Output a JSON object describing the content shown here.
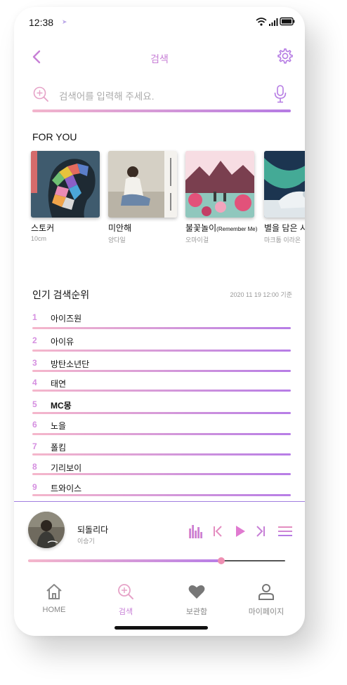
{
  "status": {
    "time": "12:38"
  },
  "header": {
    "title": "검색"
  },
  "search": {
    "placeholder": "검색어를 입력해 주세요."
  },
  "for_you": {
    "title": "FOR YOU",
    "albums": [
      {
        "name": "스토커",
        "artist": "10cm"
      },
      {
        "name": "미안해",
        "artist": "양다일"
      },
      {
        "name": "불꽃놀이",
        "name_suffix": "(Remember Me)",
        "artist": "오마이걸"
      },
      {
        "name": "별을 담은 시",
        "artist": "마크툽 이라온"
      }
    ]
  },
  "ranking": {
    "title": "인기 검색순위",
    "date": "2020 11 19 12:00 기준",
    "items": [
      {
        "rank": "1",
        "name": "아이즈원"
      },
      {
        "rank": "2",
        "name": "아이유"
      },
      {
        "rank": "3",
        "name": "방탄소년단"
      },
      {
        "rank": "4",
        "name": "태연"
      },
      {
        "rank": "5",
        "name": "MC몽"
      },
      {
        "rank": "6",
        "name": "노을"
      },
      {
        "rank": "7",
        "name": "폴킴"
      },
      {
        "rank": "8",
        "name": "기리보이"
      },
      {
        "rank": "9",
        "name": "트와이스"
      }
    ]
  },
  "player": {
    "song": "되돌리다",
    "singer": "이승기",
    "progress": 0.75
  },
  "tabs": [
    {
      "label": "HOME",
      "icon": "home-icon"
    },
    {
      "label": "검색",
      "icon": "search-icon"
    },
    {
      "label": "보관함",
      "icon": "heart-icon"
    },
    {
      "label": "마이페이지",
      "icon": "user-icon"
    }
  ],
  "colors": {
    "accent_pink": "#f3b5cc",
    "accent_purple": "#b57be3",
    "title": "#c77fd6"
  }
}
